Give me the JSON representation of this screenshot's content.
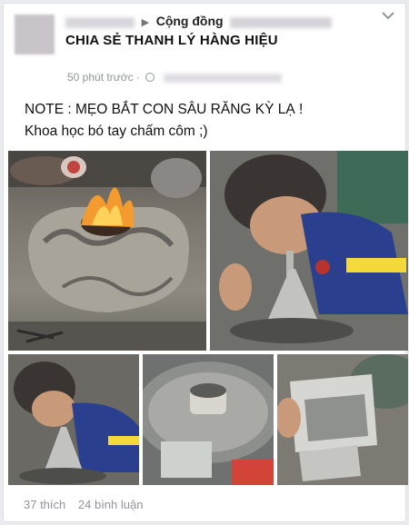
{
  "post": {
    "group_prefix": "Cộng đồng",
    "group_name": "CHIA SẺ THANH LÝ HÀNG HIỆU",
    "time": "50 phút trước",
    "separator": "·",
    "text_line1": "NOTE : MẸO BẮT CON SÂU RĂNG KỲ LẠ !",
    "text_line2": "Khoa học bó tay chấm côm ;)"
  },
  "stats": {
    "likes": "37 thích",
    "comments": "24 bình luận"
  },
  "icons": {
    "chevron": "chevron-down-icon",
    "audience": "globe-icon"
  },
  "colors": {
    "card_bg": "#ffffff",
    "page_bg": "#e9ebee",
    "meta_gray": "#90949c"
  }
}
